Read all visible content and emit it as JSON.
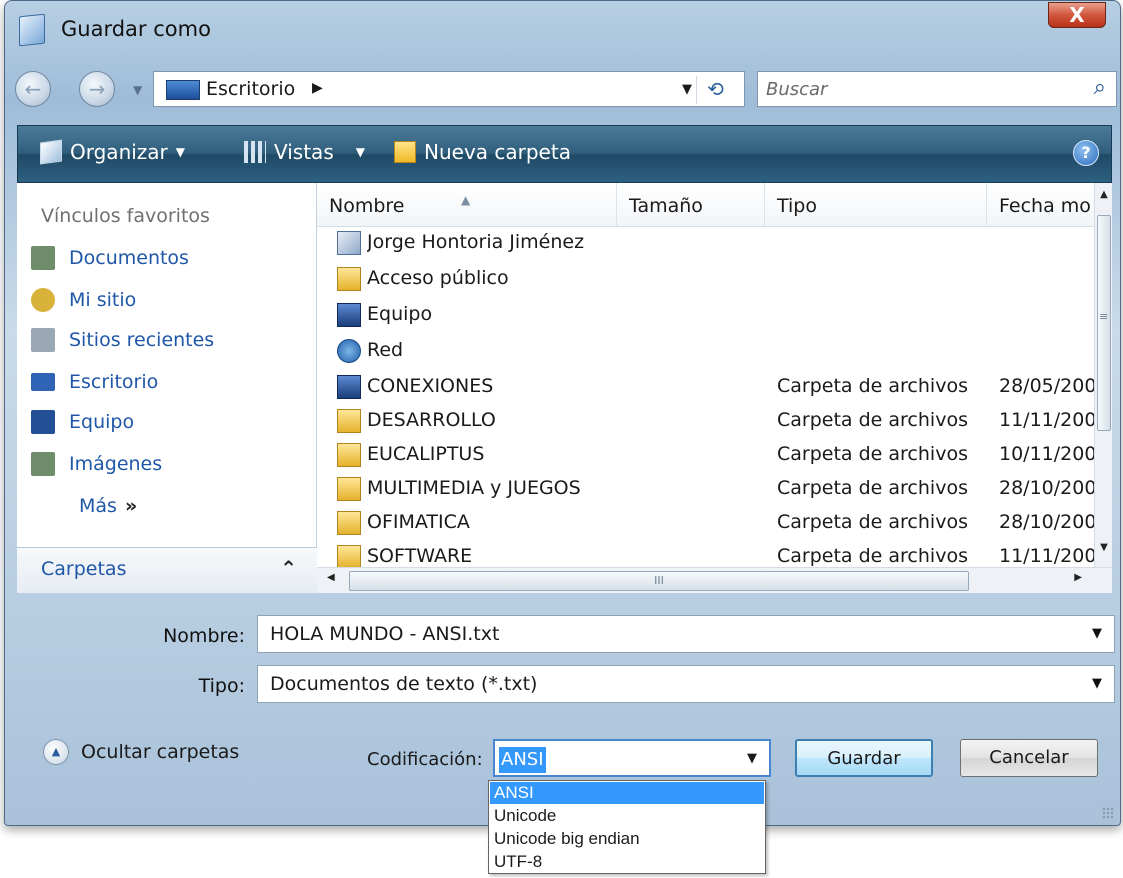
{
  "window": {
    "title": "Guardar como",
    "close_label": "X"
  },
  "nav": {
    "back_glyph": "←",
    "forward_glyph": "→",
    "address": "Escritorio",
    "address_sep": "▶",
    "address_arrow": "▼",
    "refresh_glyph": "⟲",
    "search_placeholder": "Buscar"
  },
  "toolbar": {
    "organize": "Organizar",
    "views": "Vistas",
    "new_folder": "Nueva carpeta",
    "dropdown_glyph": "▼",
    "help": "?"
  },
  "favorites": {
    "title": "Vínculos favoritos",
    "items": [
      {
        "label": "Documentos",
        "icon": "documents-icon",
        "color": "#6f8d6a"
      },
      {
        "label": "Mi sitio",
        "icon": "my-site-icon",
        "color": "#d9b23a"
      },
      {
        "label": "Sitios recientes",
        "icon": "recent-sites-icon",
        "color": "#9aa7b5"
      },
      {
        "label": "Escritorio",
        "icon": "desktop-icon",
        "color": "#2f63b6"
      },
      {
        "label": "Equipo",
        "icon": "computer-icon",
        "color": "#234f96"
      },
      {
        "label": "Imágenes",
        "icon": "images-icon",
        "color": "#6f8d6a"
      }
    ],
    "more": "Más",
    "more_glyph": "»",
    "folders": "Carpetas",
    "folders_chevron": "⌃"
  },
  "columns": [
    "Nombre",
    "Tamaño",
    "Tipo",
    "Fecha mo"
  ],
  "sort_glyph": "▲",
  "files": [
    {
      "name": "Jorge Hontoria Jiménez",
      "size": "",
      "type": "",
      "date": "",
      "icon": "user-folder-icon"
    },
    {
      "name": "Acceso público",
      "size": "",
      "type": "",
      "date": "",
      "icon": "folder-icon"
    },
    {
      "name": "Equipo",
      "size": "",
      "type": "",
      "date": "",
      "icon": "computer-icon"
    },
    {
      "name": "Red",
      "size": "",
      "type": "",
      "date": "",
      "icon": "network-icon"
    },
    {
      "name": "CONEXIONES",
      "size": "",
      "type": "Carpeta de archivos",
      "date": "28/05/200",
      "icon": "computer-icon"
    },
    {
      "name": "DESARROLLO",
      "size": "",
      "type": "Carpeta de archivos",
      "date": "11/11/200",
      "icon": "folder-icon"
    },
    {
      "name": "EUCALIPTUS",
      "size": "",
      "type": "Carpeta de archivos",
      "date": "10/11/200",
      "icon": "folder-icon"
    },
    {
      "name": "MULTIMEDIA y JUEGOS",
      "size": "",
      "type": "Carpeta de archivos",
      "date": "28/10/200",
      "icon": "folder-icon"
    },
    {
      "name": "OFIMATICA",
      "size": "",
      "type": "Carpeta de archivos",
      "date": "28/10/200",
      "icon": "folder-icon"
    },
    {
      "name": "SOFTWARE",
      "size": "",
      "type": "Carpeta de archivos",
      "date": "11/11/200",
      "icon": "folder-icon"
    }
  ],
  "scroll": {
    "up": "▲",
    "down": "▼",
    "left": "◀",
    "right": "▶",
    "grip": "≡",
    "hgrip": "III"
  },
  "form": {
    "name_label": "Nombre:",
    "name_value": "HOLA MUNDO - ANSI.txt",
    "type_label": "Tipo:",
    "type_value": "Documentos de texto (*.txt)",
    "combo_arrow": "▼",
    "hide_folders": "Ocultar carpetas",
    "hide_glyph": "▲",
    "encoding_label": "Codificación:",
    "encoding_value": "ANSI",
    "save": "Guardar",
    "cancel": "Cancelar"
  },
  "encoding_options": [
    "ANSI",
    "Unicode",
    "Unicode big endian",
    "UTF-8"
  ],
  "colors": {
    "accent": "#3399ff",
    "link": "#1f57a8",
    "toolbar": "#2f5f7c"
  }
}
